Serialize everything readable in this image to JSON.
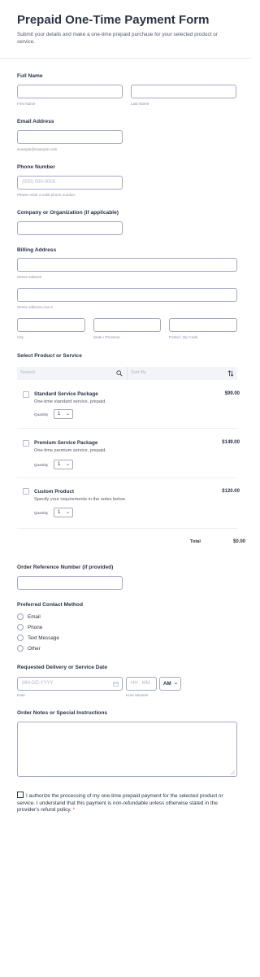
{
  "header": {
    "title": "Prepaid One-Time Payment Form",
    "subtitle": "Submit your details and make a one-time prepaid purchase for your selected product or service."
  },
  "full_name": {
    "label": "Full Name",
    "first_sub": "First Name",
    "last_sub": "Last Name"
  },
  "email": {
    "label": "Email Address",
    "sub": "example@example.com"
  },
  "phone": {
    "label": "Phone Number",
    "placeholder": "(000) 000-0000",
    "sub": "Please enter a valid phone number."
  },
  "company": {
    "label": "Company or Organization (if applicable)"
  },
  "billing": {
    "label": "Billing Address",
    "street_sub": "Street Address",
    "street2_sub": "Street Address Line 2",
    "city_sub": "City",
    "state_sub": "State / Province",
    "postal_sub": "Postal / Zip Code"
  },
  "products": {
    "label": "Select Product or Service",
    "search_placeholder": "Search",
    "sort_placeholder": "Sort By",
    "qty_label": "Quantity",
    "items": [
      {
        "name": "Standard Service Package",
        "desc": "One-time standard service, prepaid.",
        "price": "$99.00",
        "qty": "1"
      },
      {
        "name": "Premium Service Package",
        "desc": "One-time premium service, prepaid.",
        "price": "$149.00",
        "qty": "1"
      },
      {
        "name": "Custom Product",
        "desc": "Specify your requirements in the notes below.",
        "price": "$120.00",
        "qty": "1"
      }
    ],
    "total_label": "Total",
    "total_value": "$0.00"
  },
  "order_ref": {
    "label": "Order Reference Number (if provided)"
  },
  "contact": {
    "label": "Preferred Contact Method",
    "options": [
      "Email",
      "Phone",
      "Text Message",
      "Other"
    ]
  },
  "delivery": {
    "label": "Requested Delivery or Service Date",
    "date_placeholder": "MM-DD-YYYY",
    "time_placeholder": "HH : MM",
    "ampm": "AM",
    "date_sub": "Date",
    "time_sub": "Hour Minutes"
  },
  "notes": {
    "label": "Order Notes or Special Instructions"
  },
  "consent": {
    "text": "I authorize the processing of my one-time prepaid payment for the selected product or service. I understand that this payment is non-refundable unless otherwise stated in the provider's refund policy.",
    "required_mark": "*"
  },
  "colors": {
    "text": "#2c3345",
    "border": "#a4a8c4",
    "required": "#f23a3c"
  }
}
